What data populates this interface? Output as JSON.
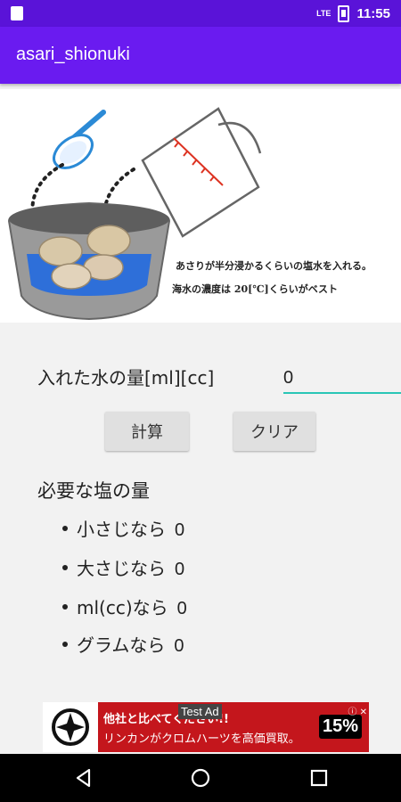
{
  "status_bar": {
    "time": "11:55",
    "signal": "LTE"
  },
  "app": {
    "title": "asari_shionuki"
  },
  "illustration": {
    "caption_line1": "あさりが半分浸かるくらいの塩水を入れる。",
    "caption_line2": "海水の濃度は 20[℃]くらいがベスト"
  },
  "form": {
    "water_label": "入れた水の量[ml][cc]",
    "water_value": "0",
    "calc_button": "計算",
    "clear_button": "クリア"
  },
  "results": {
    "title": "必要な塩の量",
    "items": [
      {
        "label": "小さじなら",
        "value": "0"
      },
      {
        "label": "大さじなら",
        "value": "0"
      },
      {
        "label": "ml(cc)なら",
        "value": "0"
      },
      {
        "label": "グラムなら",
        "value": "0"
      }
    ]
  },
  "ad": {
    "test_label": "Test Ad",
    "line1": "他社と比べてください!!",
    "line2": "リンカンがクロムハーツを高価買取。",
    "badge": "15%"
  },
  "colors": {
    "appbar": "#6a1bf0",
    "statusbar": "#5a13d8",
    "accent": "#29c6b6",
    "ad_bg": "#c4161c"
  }
}
